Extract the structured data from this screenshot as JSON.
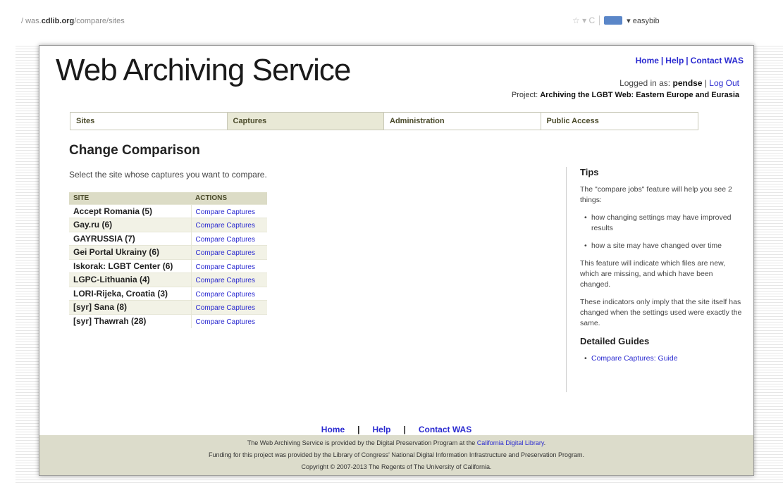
{
  "browser": {
    "url_prefix": "/ was.",
    "url_host": "cdlib.org",
    "url_path": "/compare/sites",
    "toolbar_glyphs": "☆ ▾ C",
    "extension_label": "▾ easybib"
  },
  "header": {
    "logo_text": "Web Archiving Service",
    "links": [
      "Home",
      "Help",
      "Contact WAS"
    ],
    "logged_in_prefix": "Logged in as: ",
    "username": "pendse",
    "logout": "Log Out",
    "project_prefix": "Project: ",
    "project_name": "Archiving the LGBT Web: Eastern Europe and Eurasia"
  },
  "nav": [
    "Sites",
    "Captures",
    "Administration",
    "Public Access"
  ],
  "main": {
    "title": "Change Comparison",
    "intro": "Select the site whose captures you want to compare.",
    "table": {
      "headers": [
        "SITE",
        "ACTIONS"
      ],
      "rows": [
        {
          "name": "Accept Romania (5)",
          "action": "Compare Captures"
        },
        {
          "name": "Gay.ru (6)",
          "action": "Compare Captures"
        },
        {
          "name": "GAYRUSSIA (7)",
          "action": "Compare Captures"
        },
        {
          "name": "Gei Portal Ukrainy (6)",
          "action": "Compare Captures"
        },
        {
          "name": "Iskorak: LGBT Center (6)",
          "action": "Compare Captures"
        },
        {
          "name": "LGPC-Lithuania (4)",
          "action": "Compare Captures"
        },
        {
          "name": "LORI-Rijeka, Croatia (3)",
          "action": "Compare Captures"
        },
        {
          "name": "[syr] Sana (8)",
          "action": "Compare Captures"
        },
        {
          "name": "[syr] Thawrah (28)",
          "action": "Compare Captures"
        }
      ]
    }
  },
  "tips": {
    "title": "Tips",
    "p1": "The \"compare jobs\" feature will help you see 2 things:",
    "bullets": [
      "how changing settings may have improved results",
      "how a site may have changed over time"
    ],
    "p2": "This feature will indicate which files are new, which are missing, and which have been changed.",
    "p3": "These indicators only imply that the site itself has changed when the settings used were exactly the same.",
    "guides_title": "Detailed Guides",
    "guide_link": "Compare Captures: Guide"
  },
  "footer": {
    "links": [
      "Home",
      "Help",
      "Contact WAS"
    ],
    "line1_prefix": "The Web Archiving Service is provided by the Digital Preservation Program at the ",
    "line1_link": "California Digital Library",
    "line1_suffix": ".",
    "line2": "Funding for this project was provided by the Library of Congress' National Digital Information Infrastructure and Preservation Program.",
    "line3": "Copyright © 2007-2013 The Regents of The University of California."
  }
}
